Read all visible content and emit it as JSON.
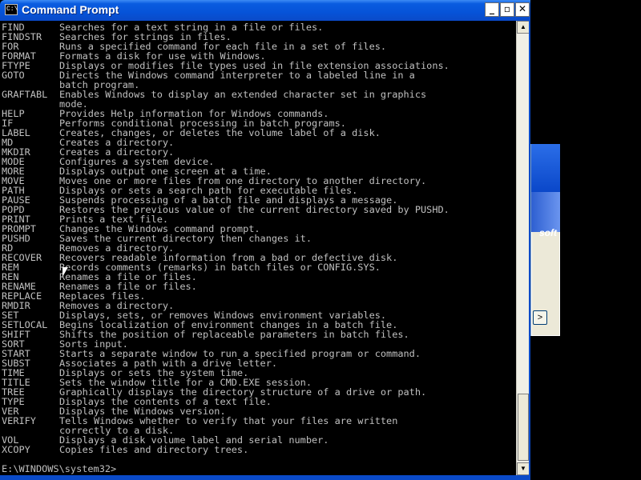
{
  "window": {
    "title": "Command Prompt",
    "icon_text": "C:\\",
    "controls": {
      "minimize": "_",
      "maximize": "▫",
      "close": "✕"
    }
  },
  "console": {
    "lines": [
      {
        "cmd": "FIND",
        "desc": "Searches for a text string in a file or files."
      },
      {
        "cmd": "FINDSTR",
        "desc": "Searches for strings in files."
      },
      {
        "cmd": "FOR",
        "desc": "Runs a specified command for each file in a set of files."
      },
      {
        "cmd": "FORMAT",
        "desc": "Formats a disk for use with Windows."
      },
      {
        "cmd": "FTYPE",
        "desc": "Displays or modifies file types used in file extension associations."
      },
      {
        "cmd": "GOTO",
        "desc": "Directs the Windows command interpreter to a labeled line in a"
      },
      {
        "cmd": "",
        "desc": "batch program."
      },
      {
        "cmd": "GRAFTABL",
        "desc": "Enables Windows to display an extended character set in graphics"
      },
      {
        "cmd": "",
        "desc": "mode."
      },
      {
        "cmd": "HELP",
        "desc": "Provides Help information for Windows commands."
      },
      {
        "cmd": "IF",
        "desc": "Performs conditional processing in batch programs."
      },
      {
        "cmd": "LABEL",
        "desc": "Creates, changes, or deletes the volume label of a disk."
      },
      {
        "cmd": "MD",
        "desc": "Creates a directory."
      },
      {
        "cmd": "MKDIR",
        "desc": "Creates a directory."
      },
      {
        "cmd": "MODE",
        "desc": "Configures a system device."
      },
      {
        "cmd": "MORE",
        "desc": "Displays output one screen at a time."
      },
      {
        "cmd": "MOVE",
        "desc": "Moves one or more files from one directory to another directory."
      },
      {
        "cmd": "PATH",
        "desc": "Displays or sets a search path for executable files."
      },
      {
        "cmd": "PAUSE",
        "desc": "Suspends processing of a batch file and displays a message."
      },
      {
        "cmd": "POPD",
        "desc": "Restores the previous value of the current directory saved by PUSHD."
      },
      {
        "cmd": "PRINT",
        "desc": "Prints a text file."
      },
      {
        "cmd": "PROMPT",
        "desc": "Changes the Windows command prompt."
      },
      {
        "cmd": "PUSHD",
        "desc": "Saves the current directory then changes it."
      },
      {
        "cmd": "RD",
        "desc": "Removes a directory."
      },
      {
        "cmd": "RECOVER",
        "desc": "Recovers readable information from a bad or defective disk."
      },
      {
        "cmd": "REM",
        "desc": "Records comments (remarks) in batch files or CONFIG.SYS."
      },
      {
        "cmd": "REN",
        "desc": "Renames a file or files."
      },
      {
        "cmd": "RENAME",
        "desc": "Renames a file or files."
      },
      {
        "cmd": "REPLACE",
        "desc": "Replaces files."
      },
      {
        "cmd": "RMDIR",
        "desc": "Removes a directory."
      },
      {
        "cmd": "SET",
        "desc": "Displays, sets, or removes Windows environment variables."
      },
      {
        "cmd": "SETLOCAL",
        "desc": "Begins localization of environment changes in a batch file."
      },
      {
        "cmd": "SHIFT",
        "desc": "Shifts the position of replaceable parameters in batch files."
      },
      {
        "cmd": "SORT",
        "desc": "Sorts input."
      },
      {
        "cmd": "START",
        "desc": "Starts a separate window to run a specified program or command."
      },
      {
        "cmd": "SUBST",
        "desc": "Associates a path with a drive letter."
      },
      {
        "cmd": "TIME",
        "desc": "Displays or sets the system time."
      },
      {
        "cmd": "TITLE",
        "desc": "Sets the window title for a CMD.EXE session."
      },
      {
        "cmd": "TREE",
        "desc": "Graphically displays the directory structure of a drive or path."
      },
      {
        "cmd": "TYPE",
        "desc": "Displays the contents of a text file."
      },
      {
        "cmd": "VER",
        "desc": "Displays the Windows version."
      },
      {
        "cmd": "VERIFY",
        "desc": "Tells Windows whether to verify that your files are written"
      },
      {
        "cmd": "",
        "desc": "correctly to a disk."
      },
      {
        "cmd": "VOL",
        "desc": "Displays a disk volume label and serial number."
      },
      {
        "cmd": "XCOPY",
        "desc": "Copies files and directory trees."
      }
    ],
    "prompt": "E:\\WINDOWS\\system32>"
  },
  "background_window": {
    "brand_fragment": "soft",
    "nav_button": ">"
  },
  "scrollbar": {
    "up_arrow": "▲",
    "down_arrow": "▼"
  },
  "colors": {
    "console_bg": "#000000",
    "console_text": "#c0c0c0",
    "titlebar": "#0a5ce0",
    "title_text": "#ffffff"
  }
}
